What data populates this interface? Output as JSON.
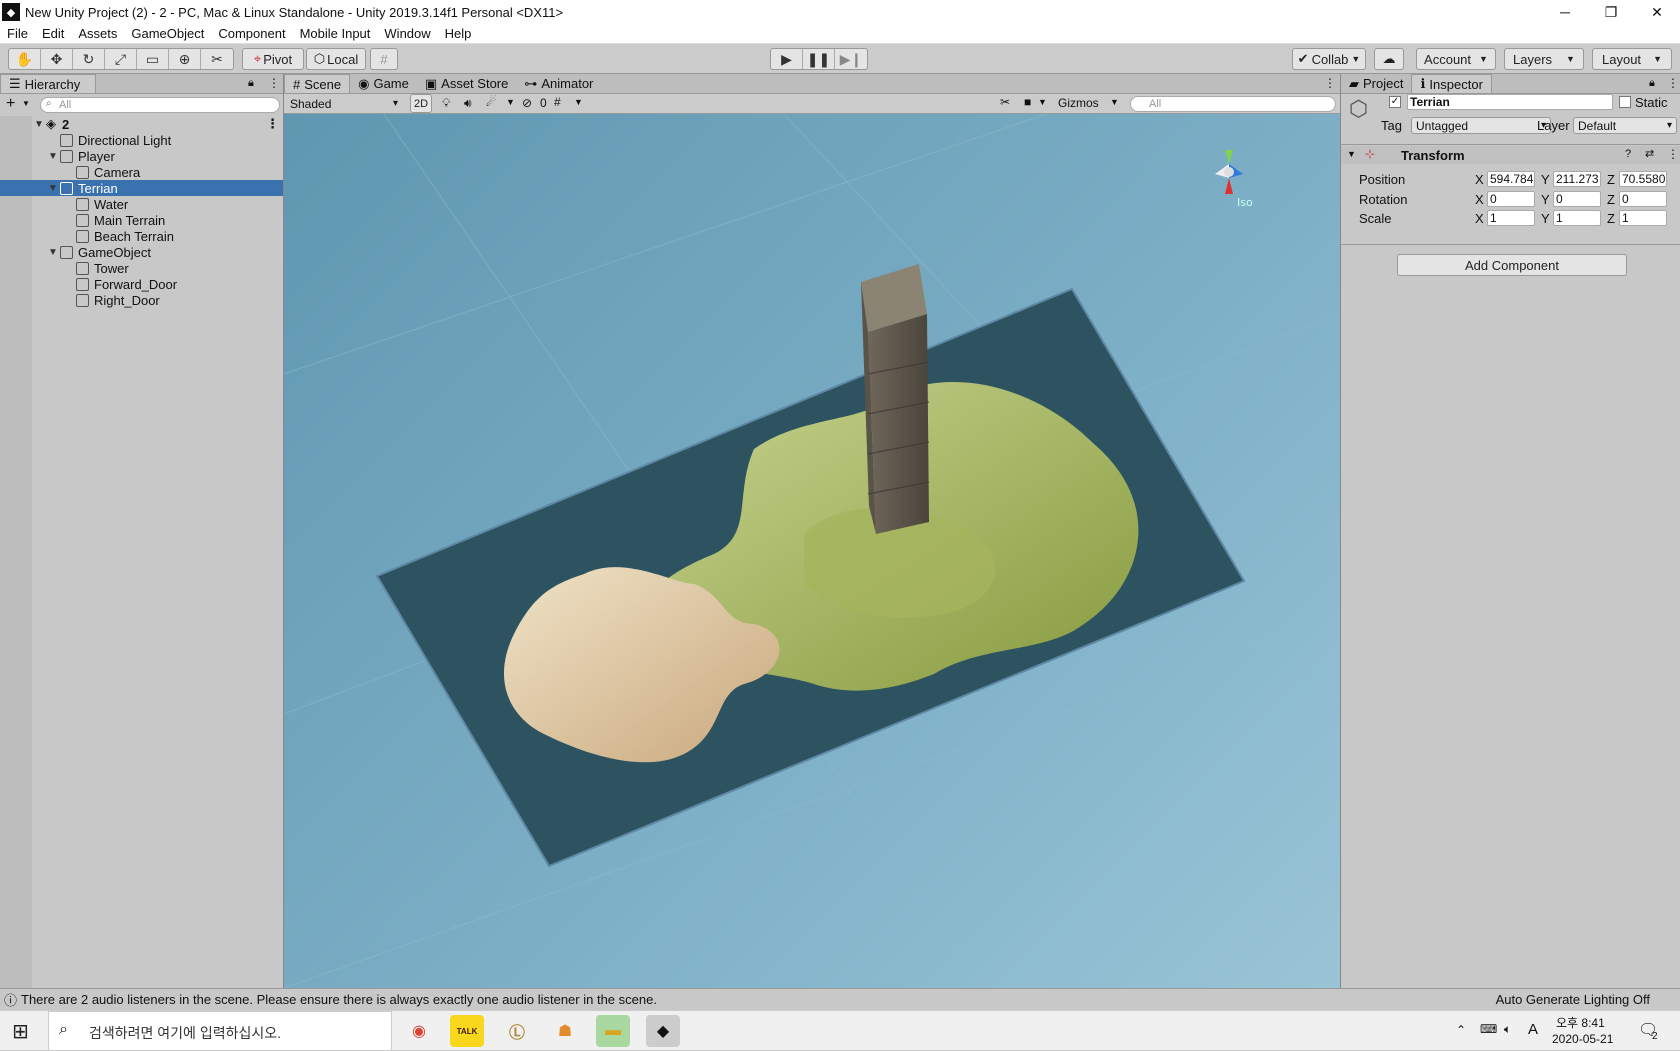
{
  "window": {
    "title": "New Unity Project (2) - 2 - PC, Mac & Linux Standalone - Unity 2019.3.14f1 Personal <DX11>",
    "minimize": "─",
    "restore": "❐",
    "close": "✕"
  },
  "menu": [
    "File",
    "Edit",
    "Assets",
    "GameObject",
    "Component",
    "Mobile Input",
    "Window",
    "Help"
  ],
  "toolbar": {
    "tools": [
      "hand-tool",
      "move-tool",
      "rotate-tool",
      "scale-tool",
      "rect-tool",
      "transform-tool",
      "custom-tool"
    ],
    "pivot": "Pivot",
    "local": "Local",
    "collab": "Collab",
    "account": "Account",
    "layers": "Layers",
    "layout": "Layout"
  },
  "hierarchy": {
    "tab": "Hierarchy",
    "search_placeholder": "All",
    "scene_name": "2",
    "items": [
      {
        "label": "Directional Light",
        "depth": 1,
        "expanded": null,
        "selected": false
      },
      {
        "label": "Player",
        "depth": 1,
        "expanded": true,
        "selected": false
      },
      {
        "label": "Camera",
        "depth": 2,
        "expanded": null,
        "selected": false
      },
      {
        "label": "Terrian",
        "depth": 1,
        "expanded": true,
        "selected": true
      },
      {
        "label": "Water",
        "depth": 2,
        "expanded": null,
        "selected": false
      },
      {
        "label": "Main Terrain",
        "depth": 2,
        "expanded": null,
        "selected": false
      },
      {
        "label": "Beach Terrain",
        "depth": 2,
        "expanded": null,
        "selected": false
      },
      {
        "label": "GameObject",
        "depth": 1,
        "expanded": true,
        "selected": false
      },
      {
        "label": "Tower",
        "depth": 2,
        "expanded": null,
        "selected": false
      },
      {
        "label": "Forward_Door",
        "depth": 2,
        "expanded": null,
        "selected": false
      },
      {
        "label": "Right_Door",
        "depth": 2,
        "expanded": null,
        "selected": false
      }
    ]
  },
  "scene": {
    "tabs": [
      "Scene",
      "Game",
      "Asset Store",
      "Animator"
    ],
    "shading": "Shaded",
    "mode_2d": "2D",
    "hidden_count": "0",
    "gizmos": "Gizmos",
    "search_placeholder": "All",
    "gizmo_label": "Iso"
  },
  "inspector": {
    "tabs": [
      "Project",
      "Inspector"
    ],
    "object_name": "Terrian",
    "static_label": "Static",
    "tag_label": "Tag",
    "tag_value": "Untagged",
    "layer_label": "Layer",
    "layer_value": "Default",
    "component": "Transform",
    "position_label": "Position",
    "rotation_label": "Rotation",
    "scale_label": "Scale",
    "position": {
      "x": "594.784",
      "y": "211.273",
      "z": "70.5580"
    },
    "rotation": {
      "x": "0",
      "y": "0",
      "z": "0"
    },
    "scale": {
      "x": "1",
      "y": "1",
      "z": "1"
    },
    "add_component": "Add Component"
  },
  "status": {
    "message": "There are 2 audio listeners in the scene. Please ensure there is always exactly one audio listener in the scene.",
    "right": "Auto Generate Lighting Off"
  },
  "taskbar": {
    "search_placeholder": "검색하려면 여기에 입력하십시오.",
    "time": "오후 8:41",
    "date": "2020-05-21",
    "lang": "A",
    "notif_count": "2",
    "kakao": "TALK"
  },
  "colors": {
    "selection": "#3a72b0",
    "viewport": "#7fb1c8"
  }
}
